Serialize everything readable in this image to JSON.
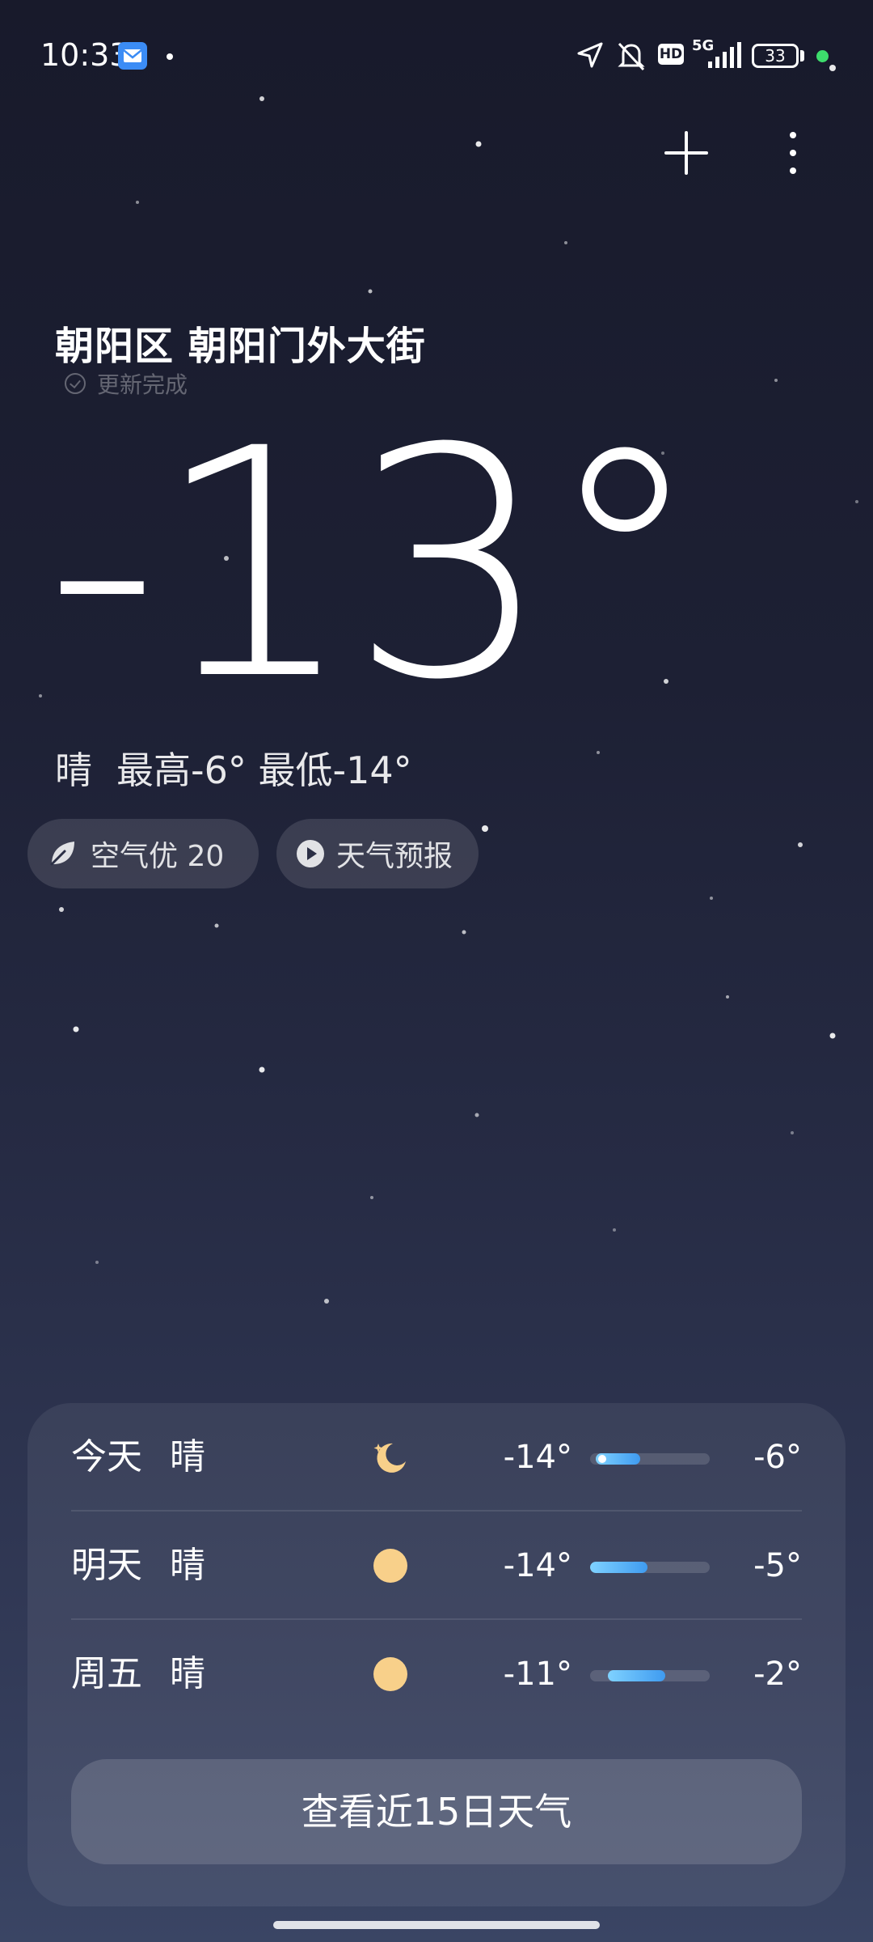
{
  "status_bar": {
    "time": "10:33",
    "battery": "33",
    "network": "5G",
    "hd": "HD",
    "icons": [
      "mail-icon",
      "location-arrow-icon",
      "bell-muted-icon",
      "hd-icon",
      "5g-signal-icon",
      "battery-icon"
    ]
  },
  "toolbar": {
    "add_icon": "plus-icon",
    "more_icon": "more-vertical-icon"
  },
  "location": "朝阳区 朝阳门外大街",
  "update_status": "更新完成",
  "current": {
    "temperature": "-13°",
    "condition": "晴",
    "high_low": "最高-6° 最低-14°"
  },
  "chips": {
    "air": "空气优 20",
    "forecast": "天气预报"
  },
  "forecast": [
    {
      "day": "今天",
      "condition": "晴",
      "icon": "moon-icon",
      "low": "-14°",
      "high": "-6°",
      "range_start": 0.05,
      "range_end": 0.42,
      "current_marker": 0.1
    },
    {
      "day": "明天",
      "condition": "晴",
      "icon": "sun-icon",
      "low": "-14°",
      "high": "-5°",
      "range_start": 0.0,
      "range_end": 0.48
    },
    {
      "day": "周五",
      "condition": "晴",
      "icon": "sun-icon",
      "low": "-11°",
      "high": "-2°",
      "range_start": 0.15,
      "range_end": 0.63
    }
  ],
  "view_15_days": "查看近15日天气",
  "colors": {
    "background_top": "#181a2b",
    "background_bottom": "#3a4564",
    "bar_gradient_start": "#7fd2ff",
    "bar_gradient_end": "#3f9bf0",
    "sun": "#f8d08a"
  }
}
